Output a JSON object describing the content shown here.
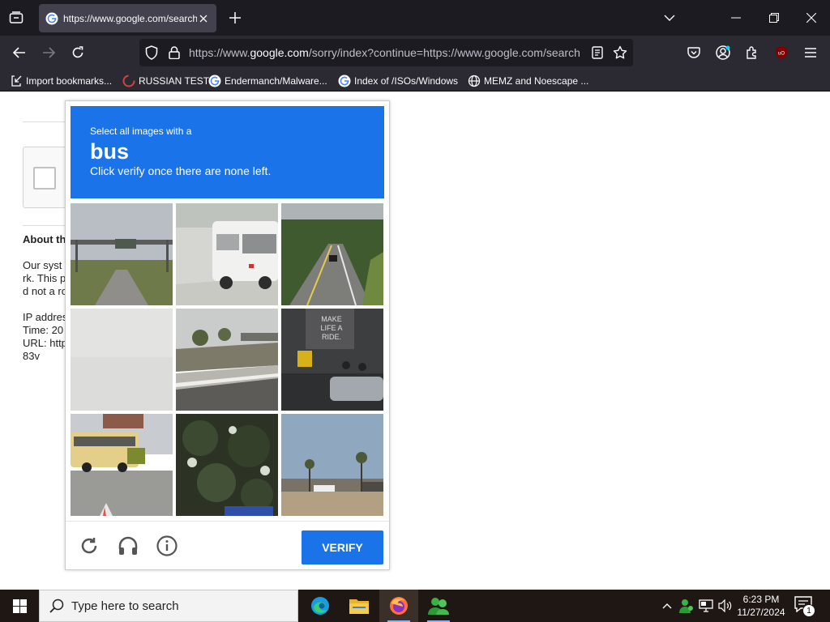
{
  "browser": {
    "tab_title": "https://www.google.com/search",
    "url_prefix": "https://www.",
    "url_domain": "google.com",
    "url_rest": "/sorry/index?continue=https://www.google.com/search",
    "bookmarks": [
      {
        "label": "Import bookmarks...",
        "icon": "import-icon"
      },
      {
        "label": "RUSSIAN TEST",
        "icon": "site-icon"
      },
      {
        "label": "Endermanch/Malware...",
        "icon": "google-icon"
      },
      {
        "label": "Index of /ISOs/Windows",
        "icon": "google-icon"
      },
      {
        "label": "MEMZ and Noescape ...",
        "icon": "globe-icon"
      }
    ],
    "accent_color": "#42414d"
  },
  "page": {
    "about_title": "About th",
    "text_lines": [
      "Our syst",
      "rk. This p",
      "d not a ro",
      "IP addres",
      "Time: 20",
      "URL: http",
      "83v"
    ]
  },
  "challenge": {
    "instruction_small": "Select all images with a",
    "target_word": "bus",
    "instruction_sub": "Click verify once there are none left.",
    "verify_label": "VERIFY",
    "header_color": "#1a73e8",
    "tiles": [
      {
        "name": "tile-highway-sign"
      },
      {
        "name": "tile-white-bus"
      },
      {
        "name": "tile-road-car"
      },
      {
        "name": "tile-blank-fog"
      },
      {
        "name": "tile-overpass-wall"
      },
      {
        "name": "tile-street-mural"
      },
      {
        "name": "tile-school-bus"
      },
      {
        "name": "tile-tree-canopy"
      },
      {
        "name": "tile-palm-road"
      }
    ]
  },
  "taskbar": {
    "search_placeholder": "Type here to search",
    "time": "6:23 PM",
    "date": "11/27/2024",
    "notification_count": "1"
  }
}
